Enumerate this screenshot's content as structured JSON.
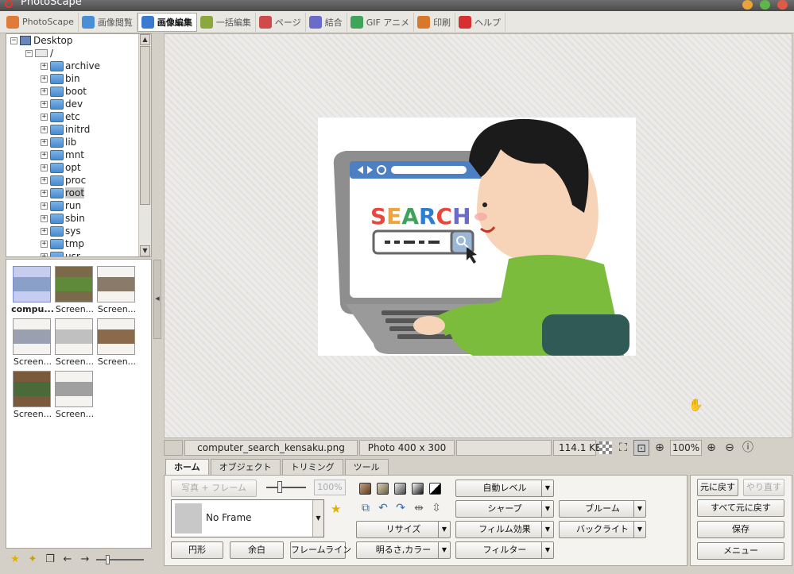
{
  "window": {
    "title": "PhotoScape"
  },
  "tabs": [
    {
      "label": "PhotoScape",
      "icon": "photoscape-icon",
      "color": "#e07b39"
    },
    {
      "label": "画像閲覧",
      "icon": "viewer-icon",
      "color": "#4a8fd6"
    },
    {
      "label": "画像編集",
      "icon": "editor-icon",
      "color": "#3b7ad1"
    },
    {
      "label": "一括編集",
      "icon": "batch-icon",
      "color": "#8aa83c"
    },
    {
      "label": "ページ",
      "icon": "page-icon",
      "color": "#cf4a4a"
    },
    {
      "label": "結合",
      "icon": "combine-icon",
      "color": "#6b6bc9"
    },
    {
      "label": "GIF アニメ",
      "icon": "gif-icon",
      "color": "#3fa45a"
    },
    {
      "label": "印刷",
      "icon": "print-icon",
      "color": "#d8782d"
    },
    {
      "label": "ヘルプ",
      "icon": "help-icon",
      "color": "#d63030"
    }
  ],
  "active_tab": "画像編集",
  "tree": {
    "root": "Desktop",
    "drive": "/",
    "folders": [
      "archive",
      "bin",
      "boot",
      "dev",
      "etc",
      "initrd",
      "lib",
      "mnt",
      "opt",
      "proc",
      "root",
      "run",
      "sbin",
      "sys",
      "tmp",
      "usr"
    ],
    "selected": "root"
  },
  "thumbnails": [
    {
      "caption": "compu...",
      "selected": true
    },
    {
      "caption": "Screen..."
    },
    {
      "caption": "Screen..."
    },
    {
      "caption": "Screen..."
    },
    {
      "caption": "Screen..."
    },
    {
      "caption": "Screen..."
    },
    {
      "caption": "Screen..."
    },
    {
      "caption": "Screen..."
    }
  ],
  "image": {
    "search_text": "SEARCH",
    "letter_colors": [
      "#e8473d",
      "#f2a33a",
      "#3fa45a",
      "#2f7dd1",
      "#e8473d",
      "#6b6bc9"
    ]
  },
  "status": {
    "filename": "computer_search_kensaku.png",
    "dimensions": "Photo 400 x 300",
    "filesize": "114.1 KB",
    "zoom": "100%"
  },
  "bottom_tabs": [
    "ホーム",
    "オブジェクト",
    "トリミング",
    "ツール"
  ],
  "home": {
    "photo_frame": "写真 + フレーム",
    "percent": "100%",
    "frame_name": "No Frame",
    "round": "円形",
    "margin": "余白",
    "frame_line": "フレームライン",
    "auto_level": "自動レベル",
    "sharpen": "シャープ",
    "bloom": "ブルーム",
    "resize": "リサイズ",
    "film_effect": "フィルム効果",
    "backlight": "バックライト",
    "brightness_color": "明るさ,カラー",
    "filter": "フィルター"
  },
  "right": {
    "undo": "元に戻す",
    "redo": "やり直す",
    "undo_all": "すべて元に戻す",
    "save": "保存",
    "menu": "メニュー"
  }
}
